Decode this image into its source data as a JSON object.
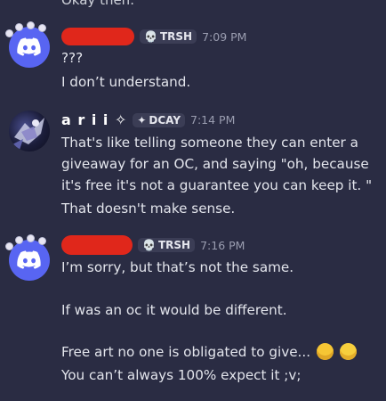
{
  "top_partial_text": "Okay then.",
  "messages": [
    {
      "author_tag": "TRSH",
      "time": "7:09 PM",
      "lines": [
        "???",
        "I don’t understand."
      ]
    },
    {
      "author_name": "a r i i ✧",
      "author_tag": "DCAY",
      "time": "7:14 PM",
      "lines": [
        "That's like telling someone they can enter a",
        "giveaway for an OC, and saying \"oh, because",
        "it's free it's not a guarantee you can keep it. \"",
        "That doesn't make sense."
      ]
    },
    {
      "author_tag": "TRSH",
      "time": "7:16 PM",
      "lines": [
        "I’m sorry, but that’s not the same.",
        "If was an oc it would be different.",
        "Free art no one is obligated to give...",
        "You can’t always 100% expect it ;v;"
      ]
    }
  ],
  "colors": {
    "background": "#2a2c43",
    "discord_blurple": "#5865f2",
    "redaction": "#e0271b"
  }
}
